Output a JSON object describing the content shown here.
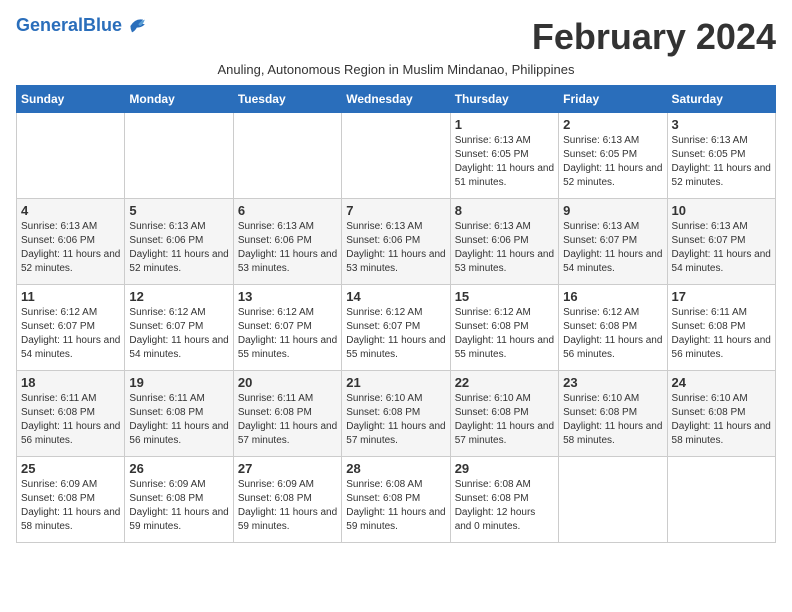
{
  "logo": {
    "text_general": "General",
    "text_blue": "Blue"
  },
  "title": "February 2024",
  "subtitle": "Anuling, Autonomous Region in Muslim Mindanao, Philippines",
  "days_of_week": [
    "Sunday",
    "Monday",
    "Tuesday",
    "Wednesday",
    "Thursday",
    "Friday",
    "Saturday"
  ],
  "weeks": [
    [
      {
        "day": "",
        "info": ""
      },
      {
        "day": "",
        "info": ""
      },
      {
        "day": "",
        "info": ""
      },
      {
        "day": "",
        "info": ""
      },
      {
        "day": "1",
        "info": "Sunrise: 6:13 AM\nSunset: 6:05 PM\nDaylight: 11 hours and 51 minutes."
      },
      {
        "day": "2",
        "info": "Sunrise: 6:13 AM\nSunset: 6:05 PM\nDaylight: 11 hours and 52 minutes."
      },
      {
        "day": "3",
        "info": "Sunrise: 6:13 AM\nSunset: 6:05 PM\nDaylight: 11 hours and 52 minutes."
      }
    ],
    [
      {
        "day": "4",
        "info": "Sunrise: 6:13 AM\nSunset: 6:06 PM\nDaylight: 11 hours and 52 minutes."
      },
      {
        "day": "5",
        "info": "Sunrise: 6:13 AM\nSunset: 6:06 PM\nDaylight: 11 hours and 52 minutes."
      },
      {
        "day": "6",
        "info": "Sunrise: 6:13 AM\nSunset: 6:06 PM\nDaylight: 11 hours and 53 minutes."
      },
      {
        "day": "7",
        "info": "Sunrise: 6:13 AM\nSunset: 6:06 PM\nDaylight: 11 hours and 53 minutes."
      },
      {
        "day": "8",
        "info": "Sunrise: 6:13 AM\nSunset: 6:06 PM\nDaylight: 11 hours and 53 minutes."
      },
      {
        "day": "9",
        "info": "Sunrise: 6:13 AM\nSunset: 6:07 PM\nDaylight: 11 hours and 54 minutes."
      },
      {
        "day": "10",
        "info": "Sunrise: 6:13 AM\nSunset: 6:07 PM\nDaylight: 11 hours and 54 minutes."
      }
    ],
    [
      {
        "day": "11",
        "info": "Sunrise: 6:12 AM\nSunset: 6:07 PM\nDaylight: 11 hours and 54 minutes."
      },
      {
        "day": "12",
        "info": "Sunrise: 6:12 AM\nSunset: 6:07 PM\nDaylight: 11 hours and 54 minutes."
      },
      {
        "day": "13",
        "info": "Sunrise: 6:12 AM\nSunset: 6:07 PM\nDaylight: 11 hours and 55 minutes."
      },
      {
        "day": "14",
        "info": "Sunrise: 6:12 AM\nSunset: 6:07 PM\nDaylight: 11 hours and 55 minutes."
      },
      {
        "day": "15",
        "info": "Sunrise: 6:12 AM\nSunset: 6:08 PM\nDaylight: 11 hours and 55 minutes."
      },
      {
        "day": "16",
        "info": "Sunrise: 6:12 AM\nSunset: 6:08 PM\nDaylight: 11 hours and 56 minutes."
      },
      {
        "day": "17",
        "info": "Sunrise: 6:11 AM\nSunset: 6:08 PM\nDaylight: 11 hours and 56 minutes."
      }
    ],
    [
      {
        "day": "18",
        "info": "Sunrise: 6:11 AM\nSunset: 6:08 PM\nDaylight: 11 hours and 56 minutes."
      },
      {
        "day": "19",
        "info": "Sunrise: 6:11 AM\nSunset: 6:08 PM\nDaylight: 11 hours and 56 minutes."
      },
      {
        "day": "20",
        "info": "Sunrise: 6:11 AM\nSunset: 6:08 PM\nDaylight: 11 hours and 57 minutes."
      },
      {
        "day": "21",
        "info": "Sunrise: 6:10 AM\nSunset: 6:08 PM\nDaylight: 11 hours and 57 minutes."
      },
      {
        "day": "22",
        "info": "Sunrise: 6:10 AM\nSunset: 6:08 PM\nDaylight: 11 hours and 57 minutes."
      },
      {
        "day": "23",
        "info": "Sunrise: 6:10 AM\nSunset: 6:08 PM\nDaylight: 11 hours and 58 minutes."
      },
      {
        "day": "24",
        "info": "Sunrise: 6:10 AM\nSunset: 6:08 PM\nDaylight: 11 hours and 58 minutes."
      }
    ],
    [
      {
        "day": "25",
        "info": "Sunrise: 6:09 AM\nSunset: 6:08 PM\nDaylight: 11 hours and 58 minutes."
      },
      {
        "day": "26",
        "info": "Sunrise: 6:09 AM\nSunset: 6:08 PM\nDaylight: 11 hours and 59 minutes."
      },
      {
        "day": "27",
        "info": "Sunrise: 6:09 AM\nSunset: 6:08 PM\nDaylight: 11 hours and 59 minutes."
      },
      {
        "day": "28",
        "info": "Sunrise: 6:08 AM\nSunset: 6:08 PM\nDaylight: 11 hours and 59 minutes."
      },
      {
        "day": "29",
        "info": "Sunrise: 6:08 AM\nSunset: 6:08 PM\nDaylight: 12 hours and 0 minutes."
      },
      {
        "day": "",
        "info": ""
      },
      {
        "day": "",
        "info": ""
      }
    ]
  ]
}
